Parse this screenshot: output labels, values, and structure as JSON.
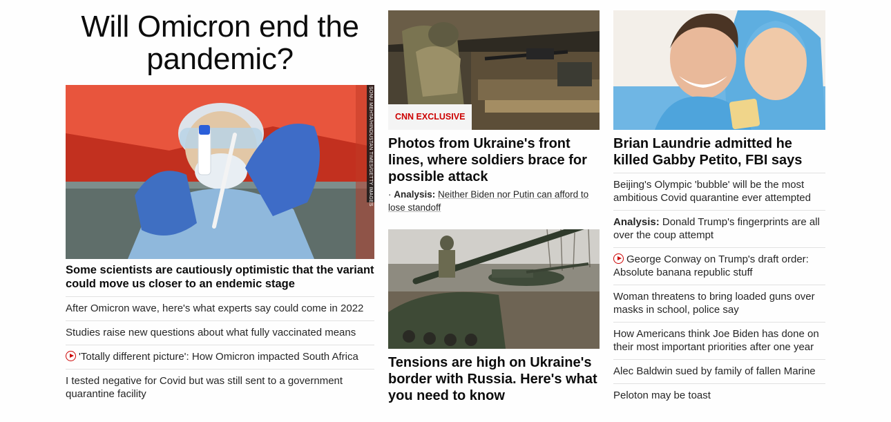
{
  "col1": {
    "title": "Will Omicron end the pandemic?",
    "image_credit": "SONU MEHTA/HINDUSTAN TIMES/GETTY IMAGES",
    "lead": "Some scientists are cautiously optimistic that the variant could move us closer to an endemic stage",
    "items": [
      {
        "text": "After Omicron wave, here's what experts say could come in 2022"
      },
      {
        "text": "Studies raise new questions about what fully vaccinated means"
      },
      {
        "text": "'Totally different picture': How Omicron impacted South Africa",
        "icon": "play-icon"
      },
      {
        "text": "I tested negative for Covid but was still sent to a government quarantine facility"
      }
    ]
  },
  "col2": {
    "badge": "CNN EXCLUSIVE",
    "headline1": "Photos from Ukraine's front lines, where soldiers brace for possible attack",
    "analysis_label": "Analysis:",
    "analysis_text": "Neither Biden nor Putin can afford to lose standoff",
    "headline2": "Tensions are high on Ukraine's border with Russia. Here's what you need to know"
  },
  "col3": {
    "headline": "Brian Laundrie admitted he killed Gabby Petito, FBI says",
    "items": [
      {
        "text": "Beijing's Olympic 'bubble' will be the most ambitious Covid quarantine ever attempted"
      },
      {
        "label": "Analysis:",
        "text": "Donald Trump's fingerprints are all over the coup attempt"
      },
      {
        "text": "George Conway on Trump's draft order: Absolute banana republic stuff",
        "icon": "play-icon"
      },
      {
        "text": "Woman threatens to bring loaded guns over masks in school, police say"
      },
      {
        "text": "How Americans think Joe Biden has done on their most important priorities after one year"
      },
      {
        "text": "Alec Baldwin sued by family of fallen Marine"
      },
      {
        "text": "Peloton may be toast"
      }
    ]
  },
  "colors": {
    "accent": "#cc0000",
    "text": "#262626",
    "divider": "#e1e1e1"
  }
}
